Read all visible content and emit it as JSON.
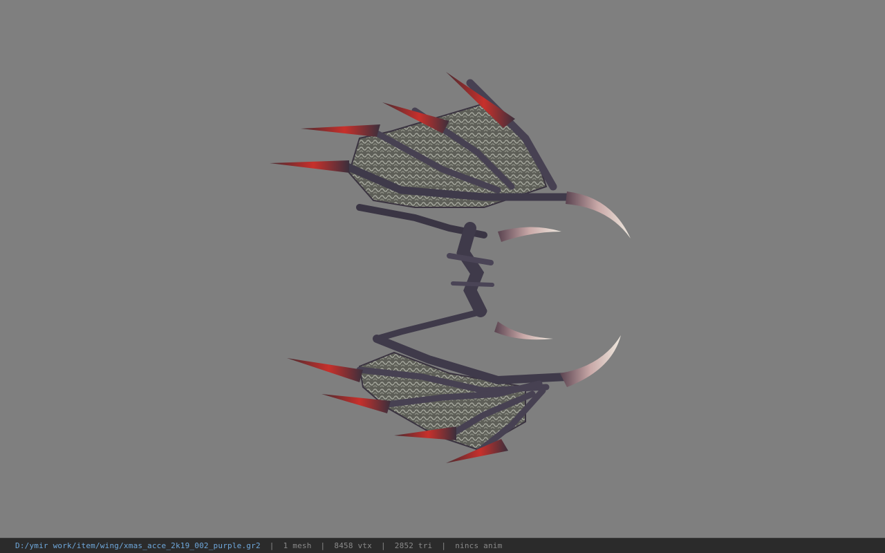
{
  "viewer": {
    "background_color": "#7f7f7f",
    "model_name": "xmas_acce_2k19_002_purple",
    "model_description": "wing"
  },
  "status_bar": {
    "file_path": "D:/ymir work/item/wing/xmas_acce_2k19_002_purple.gr2",
    "separator": "|",
    "mesh_count": "1 mesh",
    "vertex_count": "8458 vtx",
    "triangle_count": "2852 tri",
    "anim_status": "nincs anim",
    "path_color": "#6fa8dc",
    "text_color": "#8a8a8a"
  }
}
